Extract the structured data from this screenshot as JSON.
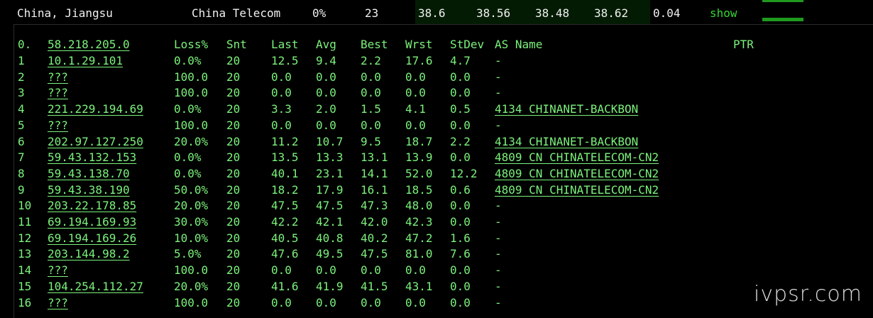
{
  "top_row": {
    "location": "China, Jiangsu",
    "isp": "China Telecom",
    "loss": "0%",
    "sent": "23",
    "last": "38.6",
    "avg": "38.56",
    "best": "38.48",
    "worst": "38.62",
    "stdev": "0.04",
    "action": "show"
  },
  "trace": {
    "header": {
      "idx": "0.",
      "host": "58.218.205.0",
      "loss": "Loss%",
      "snt": "Snt",
      "last": "Last",
      "avg": "Avg",
      "best": "Best",
      "wrst": "Wrst",
      "stdev": "StDev",
      "as": "AS Name",
      "ptr": "PTR"
    },
    "hops": [
      {
        "idx": "1",
        "host": "10.1.29.101",
        "loss": "0.0%",
        "snt": "20",
        "last": "12.5",
        "avg": "9.4",
        "best": "2.2",
        "wrst": "17.6",
        "stdev": "4.7",
        "as": "-"
      },
      {
        "idx": "2",
        "host": "???",
        "loss": "100.0",
        "snt": "20",
        "last": "0.0",
        "avg": "0.0",
        "best": "0.0",
        "wrst": "0.0",
        "stdev": "0.0",
        "as": "-"
      },
      {
        "idx": "3",
        "host": "???",
        "loss": "100.0",
        "snt": "20",
        "last": "0.0",
        "avg": "0.0",
        "best": "0.0",
        "wrst": "0.0",
        "stdev": "0.0",
        "as": "-"
      },
      {
        "idx": "4",
        "host": "221.229.194.69",
        "loss": "0.0%",
        "snt": "20",
        "last": "3.3",
        "avg": "2.0",
        "best": "1.5",
        "wrst": "4.1",
        "stdev": "0.5",
        "as": "4134  CHINANET-BACKBON"
      },
      {
        "idx": "5",
        "host": "???",
        "loss": "100.0",
        "snt": "20",
        "last": "0.0",
        "avg": "0.0",
        "best": "0.0",
        "wrst": "0.0",
        "stdev": "0.0",
        "as": "-"
      },
      {
        "idx": "6",
        "host": "202.97.127.250",
        "loss": "20.0%",
        "snt": "20",
        "last": "11.2",
        "avg": "10.7",
        "best": "9.5",
        "wrst": "18.7",
        "stdev": "2.2",
        "as": "4134  CHINANET-BACKBON"
      },
      {
        "idx": "7",
        "host": "59.43.132.153",
        "loss": "0.0%",
        "snt": "20",
        "last": "13.5",
        "avg": "13.3",
        "best": "13.1",
        "wrst": "13.9",
        "stdev": "0.0",
        "as": "4809  CN CHINATELECOM-CN2"
      },
      {
        "idx": "8",
        "host": "59.43.138.70",
        "loss": "0.0%",
        "snt": "20",
        "last": "40.1",
        "avg": "23.1",
        "best": "14.1",
        "wrst": "52.0",
        "stdev": "12.2",
        "as": "4809  CN CHINATELECOM-CN2"
      },
      {
        "idx": "9",
        "host": "59.43.38.190",
        "loss": "50.0%",
        "snt": "20",
        "last": "18.2",
        "avg": "17.9",
        "best": "16.1",
        "wrst": "18.5",
        "stdev": "0.6",
        "as": "4809  CN CHINATELECOM-CN2"
      },
      {
        "idx": "10",
        "host": "203.22.178.85",
        "loss": "20.0%",
        "snt": "20",
        "last": "47.5",
        "avg": "47.5",
        "best": "47.3",
        "wrst": "48.0",
        "stdev": "0.0",
        "as": "-"
      },
      {
        "idx": "11",
        "host": "69.194.169.93",
        "loss": "30.0%",
        "snt": "20",
        "last": "42.2",
        "avg": "42.1",
        "best": "42.0",
        "wrst": "42.3",
        "stdev": "0.0",
        "as": "-"
      },
      {
        "idx": "12",
        "host": "69.194.169.26",
        "loss": "10.0%",
        "snt": "20",
        "last": "40.5",
        "avg": "40.8",
        "best": "40.2",
        "wrst": "47.2",
        "stdev": "1.6",
        "as": "-"
      },
      {
        "idx": "13",
        "host": "203.144.98.2",
        "loss": "5.0%",
        "snt": "20",
        "last": "47.6",
        "avg": "49.5",
        "best": "47.5",
        "wrst": "81.0",
        "stdev": "7.6",
        "as": "-"
      },
      {
        "idx": "14",
        "host": "???",
        "loss": "100.0",
        "snt": "20",
        "last": "0.0",
        "avg": "0.0",
        "best": "0.0",
        "wrst": "0.0",
        "stdev": "0.0",
        "as": "-"
      },
      {
        "idx": "15",
        "host": "104.254.112.27",
        "loss": "20.0%",
        "snt": "20",
        "last": "41.6",
        "avg": "41.9",
        "best": "41.5",
        "wrst": "43.1",
        "stdev": "0.0",
        "as": "-"
      },
      {
        "idx": "16",
        "host": "???",
        "loss": "100.0",
        "snt": "20",
        "last": "0.0",
        "avg": "0.0",
        "best": "0.0",
        "wrst": "0.0",
        "stdev": "0.0",
        "as": "-"
      }
    ]
  },
  "watermark": "ivpsr.com",
  "colors": {
    "text_green": "#7bf27b",
    "show_green": "#33d633",
    "bar_green": "#1f9a1f",
    "background": "#000000"
  }
}
